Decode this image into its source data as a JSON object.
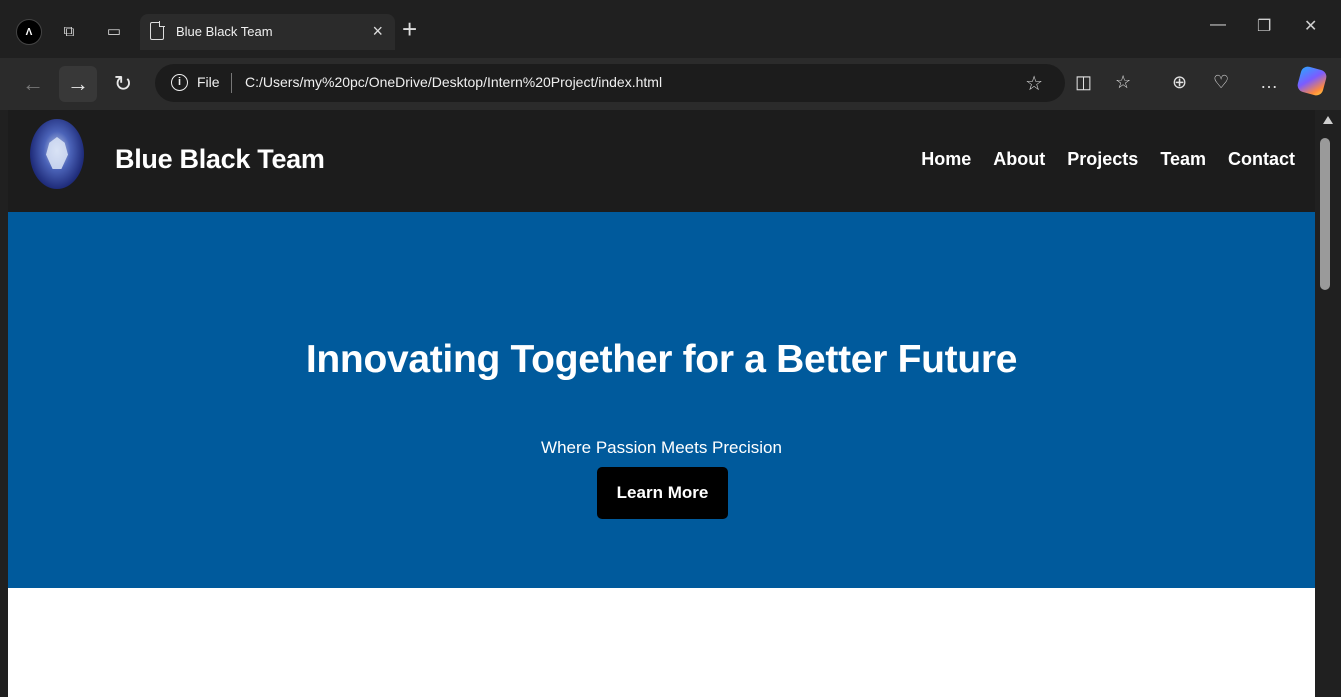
{
  "browser": {
    "profile_label": "Ʌ",
    "tab_title": "Blue Black Team",
    "address_prefix": "File",
    "url": "C:/Users/my%20pc/OneDrive/Desktop/Intern%20Project/index.html"
  },
  "site": {
    "title": "Blue Black Team",
    "nav": [
      "Home",
      "About",
      "Projects",
      "Team",
      "Contact"
    ]
  },
  "hero": {
    "title": "Innovating Together for a Better Future",
    "subtitle": "Where Passion Meets Precision",
    "button_label": "Learn More"
  },
  "colors": {
    "header_bg": "#1c1c1c",
    "hero_bg": "#005a9c",
    "button_bg": "#000000"
  }
}
